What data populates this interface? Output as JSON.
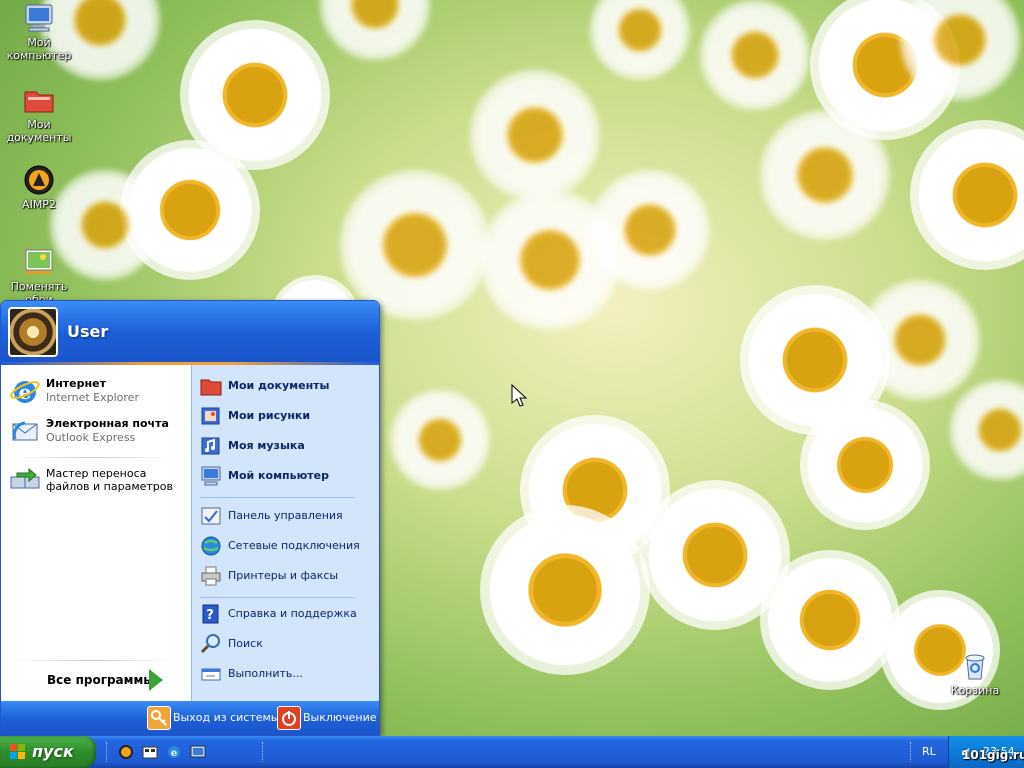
{
  "desktop": {
    "icons": [
      {
        "label": "Мой\nкомпьютер",
        "icon": "my-computer-icon"
      },
      {
        "label": "Мои\nдокументы",
        "icon": "my-documents-icon"
      },
      {
        "label": "AIMP2",
        "icon": "aimp2-icon"
      },
      {
        "label": "Поменять\nобои",
        "icon": "change-wallpaper-icon"
      },
      {
        "label": "Корзина",
        "icon": "recycle-bin-icon"
      }
    ]
  },
  "start_menu": {
    "user": "User",
    "pinned": [
      {
        "title": "Интернет",
        "subtitle": "Internet Explorer",
        "icon": "internet-explorer-icon"
      },
      {
        "title": "Электронная почта",
        "subtitle": "Outlook Express",
        "icon": "outlook-express-icon"
      }
    ],
    "recent": [
      {
        "title": "Мастер переноса файлов и параметров",
        "icon": "transfer-wizard-icon"
      }
    ],
    "all_programs": "Все программы",
    "right": {
      "top": [
        {
          "label": "Мои документы",
          "icon": "my-documents-icon"
        },
        {
          "label": "Мои рисунки",
          "icon": "my-pictures-icon"
        },
        {
          "label": "Моя музыка",
          "icon": "my-music-icon"
        },
        {
          "label": "Мой компьютер",
          "icon": "my-computer-icon"
        }
      ],
      "middle": [
        {
          "label": "Панель управления",
          "icon": "control-panel-icon"
        },
        {
          "label": "Сетевые подключения",
          "icon": "network-connections-icon"
        },
        {
          "label": "Принтеры и факсы",
          "icon": "printers-icon"
        }
      ],
      "bottom": [
        {
          "label": "Справка и поддержка",
          "icon": "help-icon"
        },
        {
          "label": "Поиск",
          "icon": "search-icon"
        },
        {
          "label": "Выполнить...",
          "icon": "run-icon"
        }
      ]
    },
    "footer": {
      "logoff": "Выход из системы",
      "shutdown": "Выключение"
    }
  },
  "taskbar": {
    "start_label": "пуск",
    "language": "RL",
    "clock": "23:54"
  },
  "watermark": "101gig.ru",
  "colors": {
    "taskbar_blue": "#1f5bd4",
    "start_green": "#2c8e2b",
    "menu_right_bg": "#d3e5fa",
    "tray_blue": "#0c78d6"
  }
}
